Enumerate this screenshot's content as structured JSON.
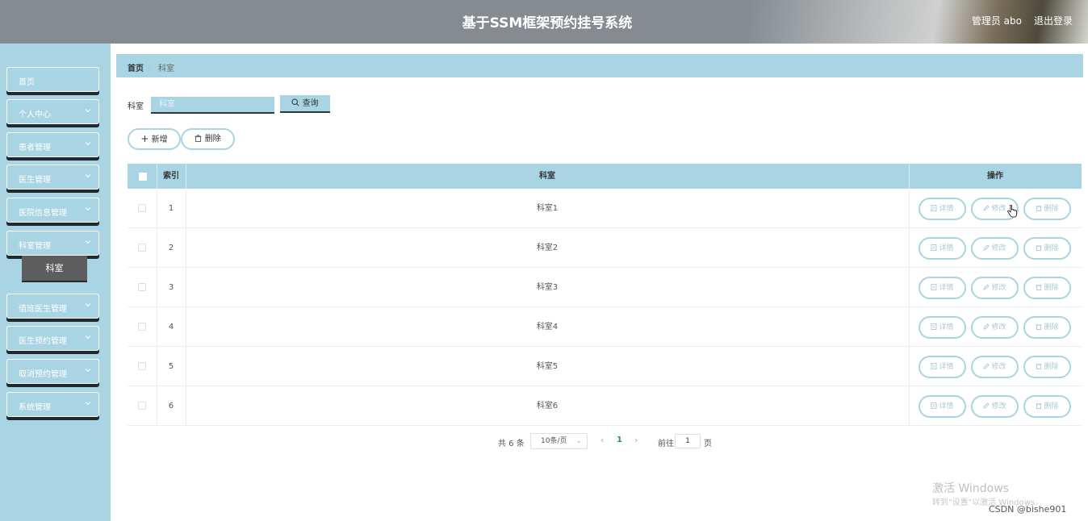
{
  "header": {
    "title": "基于SSM框架预约挂号系统",
    "user": "管理员 abo",
    "logout": "退出登录"
  },
  "sidebar": {
    "items": [
      {
        "label": "首页",
        "has_chevron": false
      },
      {
        "label": "个人中心",
        "has_chevron": true
      },
      {
        "label": "患者管理",
        "has_chevron": true
      },
      {
        "label": "医生管理",
        "has_chevron": true
      },
      {
        "label": "医院信息管理",
        "has_chevron": true
      },
      {
        "label": "科室管理",
        "has_chevron": true
      },
      {
        "label": "值班医生管理",
        "has_chevron": true
      },
      {
        "label": "医生预约管理",
        "has_chevron": true
      },
      {
        "label": "取消预约管理",
        "has_chevron": true
      },
      {
        "label": "系统管理",
        "has_chevron": true
      }
    ],
    "submenu_active": "科室"
  },
  "breadcrumb": {
    "home": "首页",
    "separator": "/",
    "current": "科室"
  },
  "search": {
    "label": "科室",
    "placeholder": "科室",
    "value": "",
    "button_label": "查询"
  },
  "actions": {
    "add_label": "新增",
    "delete_label": "删除"
  },
  "table": {
    "columns": [
      "索引",
      "科室",
      "操作"
    ],
    "rows": [
      {
        "index": "1",
        "name": "科室1"
      },
      {
        "index": "2",
        "name": "科室2"
      },
      {
        "index": "3",
        "name": "科室3"
      },
      {
        "index": "4",
        "name": "科室4"
      },
      {
        "index": "5",
        "name": "科室5"
      },
      {
        "index": "6",
        "name": "科室6"
      }
    ],
    "row_actions": [
      "详情",
      "修改",
      "删除"
    ]
  },
  "pagination": {
    "total": "共 6 条",
    "page_size": "10条/页",
    "current_page": "1",
    "goto_label": "前往",
    "goto_value": "1",
    "page_suffix": "页"
  },
  "watermark": {
    "windows_line1": "激活 Windows",
    "windows_line2": "转到\"设置\"以激活 Windows。",
    "csdn": "CSDN @bishe901"
  },
  "colors": {
    "accent": "#a9d4e3",
    "header_bg": "#858b90",
    "submenu_active_bg": "#5d5d5d"
  }
}
